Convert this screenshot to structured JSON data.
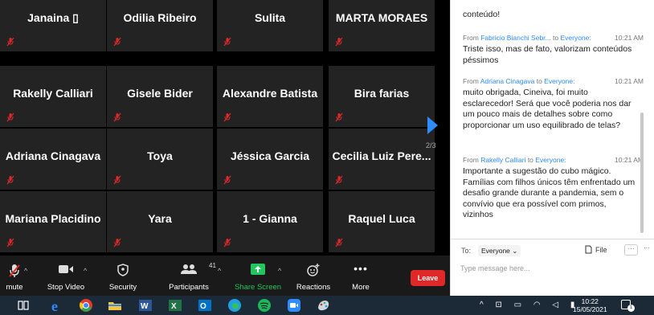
{
  "participants": [
    "Janaina ▯",
    "Odilia Ribeiro",
    "Sulita",
    "MARTA MORAES",
    "Rakelly Calliari",
    "Gisele Bider",
    "Alexandre Batista",
    "Bira farias",
    "Adriana Cinagava",
    "Toya",
    "Jéssica Garcia",
    "Cecilia Luiz Pere...",
    "Mariana Placidino",
    "Yara",
    "1 - Gianna",
    "Raquel Luca"
  ],
  "grid": {
    "page_indicator": "2/3"
  },
  "toolbar": {
    "mute": "mute",
    "stop_video": "Stop Video",
    "security": "Security",
    "participants": "Participants",
    "participants_count": "41",
    "share_screen": "Share Screen",
    "reactions": "Reactions",
    "more": "More",
    "leave": "Leave"
  },
  "chat": {
    "messages": [
      {
        "from": "",
        "to": "",
        "time": "",
        "text": "conteúdo!"
      },
      {
        "from": "Fabricio Bianchi Sebr...",
        "to": "Everyone:",
        "time": "10:21 AM",
        "text": "Triste isso, mas de fato, valorizam conteúdos péssimos"
      },
      {
        "from": "Adriana Cinagava",
        "to": "Everyone:",
        "time": "10:21 AM",
        "text": "muito obrigada, Cineiva, foi muito esclarecedor! Será que você poderia nos dar um pouco mais de detalhes sobre como proporcionar um uso equilibrado de telas?"
      },
      {
        "from": "Rakelly Calliari",
        "to": "Everyone:",
        "time": "10:21 AM",
        "text": "Importante a sugestão do cubo mágico. Famílias com filhos únicos têm enfrentado um desafio grande durante a pandemia, sem o convívio que era possível com primos, vizinhos"
      }
    ],
    "from_label": "From",
    "to_word": "to",
    "to_label": "To:",
    "recipient": "Everyone",
    "file_label": "File",
    "more_label": "···",
    "input_placeholder": "Type message here..."
  },
  "taskbar": {
    "time": "10:22",
    "date": "15/05/2021"
  },
  "colors": {
    "accent": "#2d8cff",
    "leave": "#e02828",
    "share": "#22c55e",
    "muted": "#e02828",
    "tile": "#232323"
  }
}
